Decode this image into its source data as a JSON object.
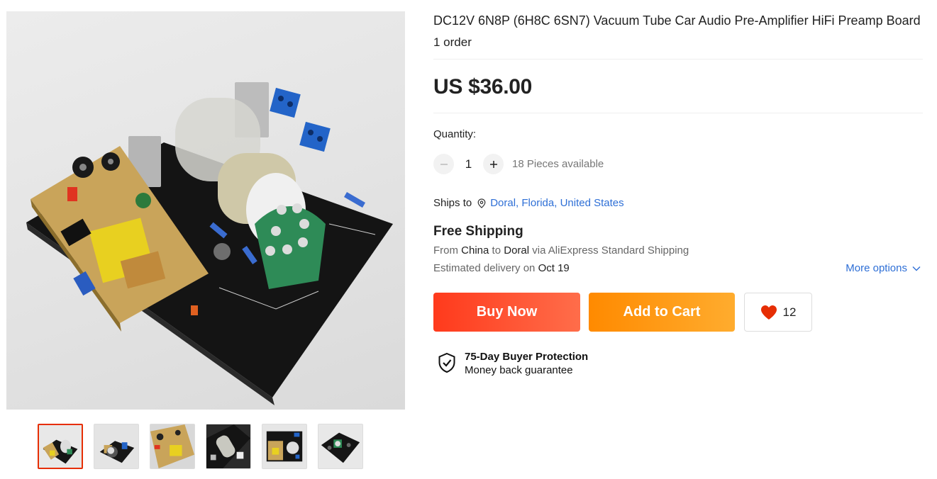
{
  "product": {
    "title": "DC12V 6N8P (6H8C 6SN7) Vacuum Tube Car Audio Pre-Amplifier HiFi Preamp Board",
    "orders": "1 order",
    "price": "US $36.00"
  },
  "quantity": {
    "label": "Quantity:",
    "value": "1",
    "minus_icon": "minus-icon",
    "plus_icon": "plus-icon",
    "available": "18 Pieces available"
  },
  "shipping": {
    "ships_to_label": "Ships to",
    "location": "Doral, Florida, United States",
    "free_shipping": "Free Shipping",
    "from_label": "From",
    "from_country": "China",
    "to_label": "to",
    "to_city": "Doral",
    "via_text": "via AliExpress Standard Shipping",
    "eta_label": "Estimated delivery on",
    "eta_date": "Oct 19",
    "more_options": "More options"
  },
  "actions": {
    "buy_now": "Buy Now",
    "add_to_cart": "Add to Cart",
    "wishlist_count": "12"
  },
  "protection": {
    "title": "75-Day Buyer Protection",
    "subtitle": "Money back guarantee"
  },
  "gallery": {
    "thumbnail_count": 6,
    "active_index": 0
  },
  "colors": {
    "buy_now": "#ff3a1c",
    "add_to_cart": "#ff8a00",
    "link": "#2e6fd6",
    "active_thumb_border": "#e62e04",
    "heart": "#e62e04"
  }
}
